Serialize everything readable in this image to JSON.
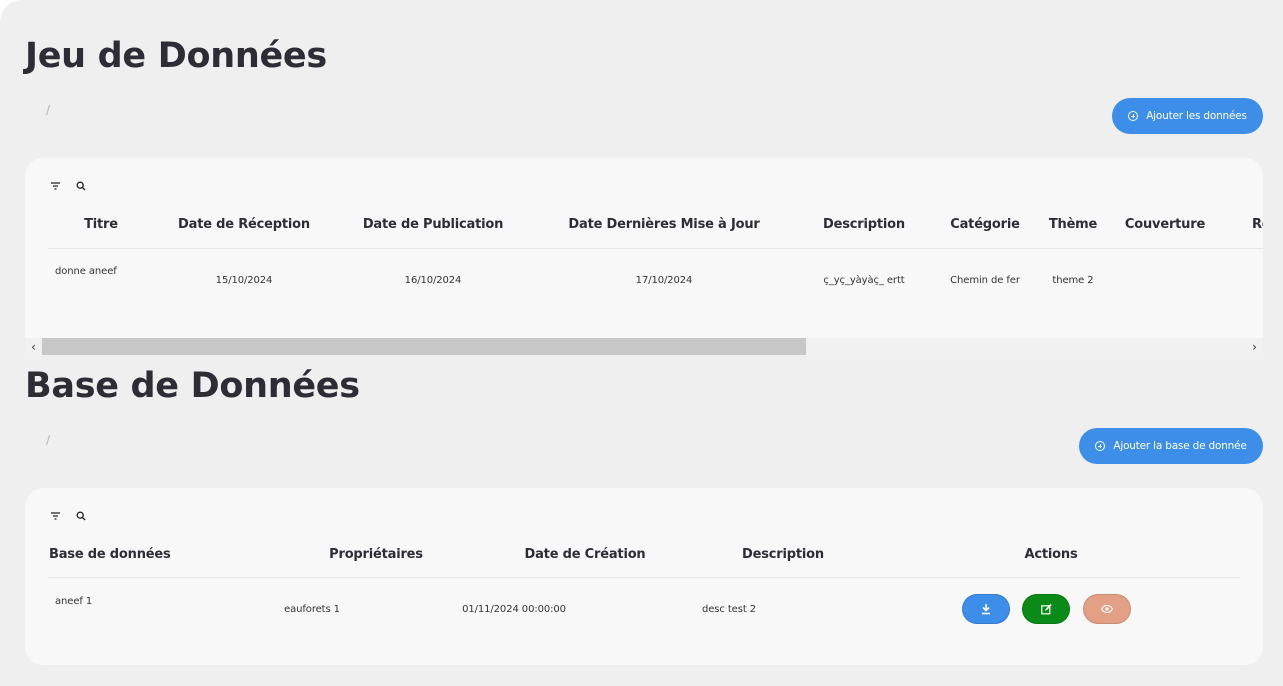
{
  "jeu": {
    "title": "Jeu de Données",
    "breadcrumb": "/",
    "add_label": "Ajouter les données",
    "columns": [
      "Titre",
      "Date de Réception",
      "Date de Publication",
      "Date Dernières Mise à Jour",
      "Description",
      "Catégorie",
      "Thème",
      "Couverture",
      "Re"
    ],
    "rows": [
      {
        "titre": "donne aneef",
        "date_reception": "15/10/2024",
        "date_publication": "16/10/2024",
        "date_maj": "17/10/2024",
        "description": "ç_yç_yàyàç_ ertt",
        "categorie": "Chemin de fer",
        "theme": "theme 2"
      }
    ]
  },
  "base": {
    "title": "Base de Données",
    "breadcrumb": "/",
    "add_label": "Ajouter la base de donnée",
    "columns": [
      "Base de données",
      "Propriétaires",
      "Date de Création",
      "Description",
      "Actions"
    ],
    "rows": [
      {
        "base": "aneef 1",
        "proprietaire": "eauforets 1",
        "date_creation": "01/11/2024 00:00:00",
        "description": "desc test 2"
      }
    ]
  },
  "icons": {
    "filter": "filter-icon",
    "search": "search-icon",
    "add": "plus-circle-icon",
    "download": "download-icon",
    "edit": "edit-icon",
    "view": "eye-icon",
    "scroll_left": "chevron-left-icon",
    "scroll_right": "chevron-right-icon"
  },
  "colors": {
    "primary": "#3c8ee8",
    "edit": "#0a8a16",
    "view": "#e3a085",
    "heading": "#2e2c35"
  }
}
